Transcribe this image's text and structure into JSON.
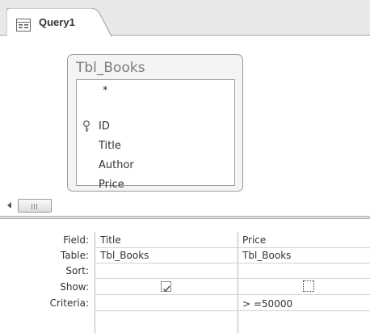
{
  "tab": {
    "label": "Query1",
    "icon": "query-design-icon"
  },
  "table": {
    "name": "Tbl_Books",
    "fields": [
      "*",
      "ID",
      "Title",
      "Author",
      "Price"
    ],
    "key_field": "ID"
  },
  "grid": {
    "row_labels": {
      "field": "Field:",
      "table": "Table:",
      "sort": "Sort:",
      "show": "Show:",
      "criteria": "Criteria:"
    },
    "columns": [
      {
        "field": "Title",
        "table": "Tbl_Books",
        "sort": "",
        "show": true,
        "criteria": ""
      },
      {
        "field": "Price",
        "table": "Tbl_Books",
        "sort": "",
        "show": false,
        "criteria": "> =50000"
      }
    ]
  }
}
